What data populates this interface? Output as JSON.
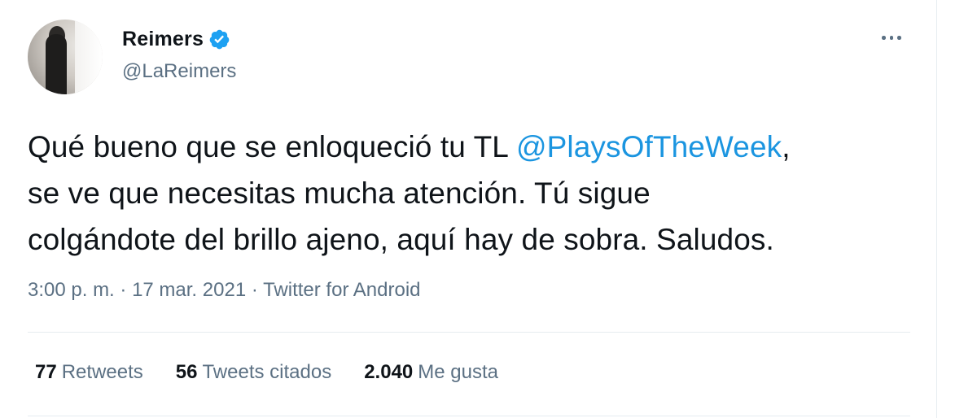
{
  "user": {
    "display_name": "Reimers",
    "handle": "@LaReimers",
    "verified_icon": "verified-badge-icon",
    "verified_color": "#1da1f2"
  },
  "tweet": {
    "text_part1": "Qué bueno que se enloqueció tu TL ",
    "mention": "@PlaysOfTheWeek",
    "text_part2": ",",
    "line2": "se ve que necesitas mucha atención. Tú sigue",
    "line3": "colgándote del brillo ajeno, aquí hay de sobra. Saludos."
  },
  "meta": {
    "time": "3:00 p. m.",
    "separator1": " · ",
    "date": "17 mar. 2021",
    "separator2": " · ",
    "source": "Twitter for Android"
  },
  "stats": {
    "retweets_count": "77",
    "retweets_label": "Retweets",
    "quotes_count": "56",
    "quotes_label": "Tweets citados",
    "likes_count": "2.040",
    "likes_label": "Me gusta"
  },
  "colors": {
    "mention": "#1b95e0",
    "secondary_text": "#5b7083",
    "primary_text": "#0f1419",
    "divider": "#e6ecf0"
  }
}
